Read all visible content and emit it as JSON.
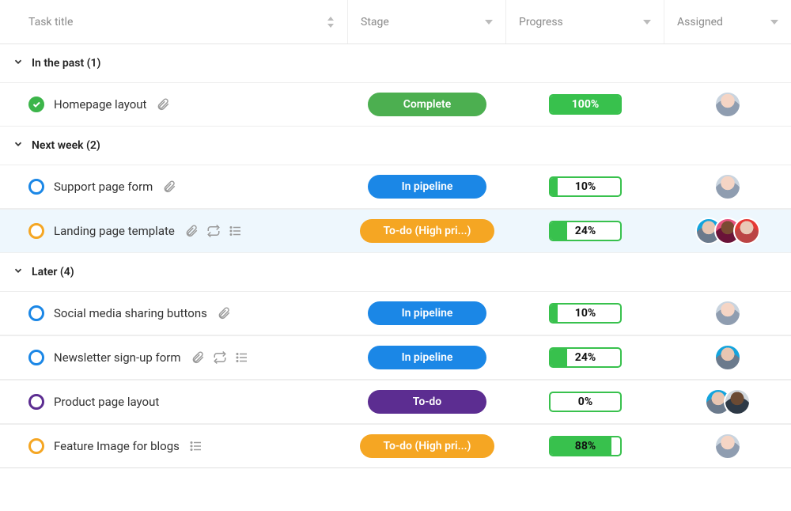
{
  "columns": {
    "title": "Task title",
    "stage": "Stage",
    "progress": "Progress",
    "assigned": "Assigned"
  },
  "groups": [
    {
      "label": "In the past (1)",
      "tasks": [
        {
          "name": "Homepage layout",
          "status": "complete",
          "icons": [
            "attachment"
          ],
          "stage": {
            "label": "Complete",
            "color": "green"
          },
          "progress": {
            "value": 100,
            "label": "100%"
          },
          "assignees": [
            "face"
          ]
        }
      ]
    },
    {
      "label": "Next week (2)",
      "tasks": [
        {
          "name": "Support page form",
          "status": "blue",
          "icons": [
            "attachment"
          ],
          "stage": {
            "label": "In pipeline",
            "color": "blue"
          },
          "progress": {
            "value": 10,
            "label": "10%"
          },
          "assignees": [
            "face"
          ]
        },
        {
          "name": "Landing page template",
          "status": "orange",
          "highlighted": true,
          "icons": [
            "attachment",
            "repeat",
            "list"
          ],
          "stage": {
            "label": "To-do (High pri...)",
            "color": "orange"
          },
          "progress": {
            "value": 24,
            "label": "24%"
          },
          "assignees": [
            "face2",
            "facepink",
            "face4"
          ]
        }
      ]
    },
    {
      "label": "Later (4)",
      "tasks": [
        {
          "name": "Social media sharing buttons",
          "status": "blue",
          "icons": [
            "attachment"
          ],
          "stage": {
            "label": "In pipeline",
            "color": "blue"
          },
          "progress": {
            "value": 10,
            "label": "10%"
          },
          "assignees": [
            "face"
          ]
        },
        {
          "name": "Newsletter sign-up form",
          "status": "blue",
          "icons": [
            "attachment",
            "repeat",
            "list"
          ],
          "stage": {
            "label": "In pipeline",
            "color": "blue"
          },
          "progress": {
            "value": 24,
            "label": "24%"
          },
          "assignees": [
            "face2"
          ]
        },
        {
          "name": "Product page layout",
          "status": "purple",
          "icons": [],
          "stage": {
            "label": "To-do",
            "color": "purple"
          },
          "progress": {
            "value": 0,
            "label": "0%"
          },
          "assignees": [
            "face2",
            "face3"
          ]
        },
        {
          "name": "Feature Image for blogs",
          "status": "orange",
          "icons": [
            "list"
          ],
          "stage": {
            "label": "To-do (High pri...)",
            "color": "orange"
          },
          "progress": {
            "value": 88,
            "label": "88%"
          },
          "assignees": [
            "face"
          ]
        }
      ]
    }
  ]
}
